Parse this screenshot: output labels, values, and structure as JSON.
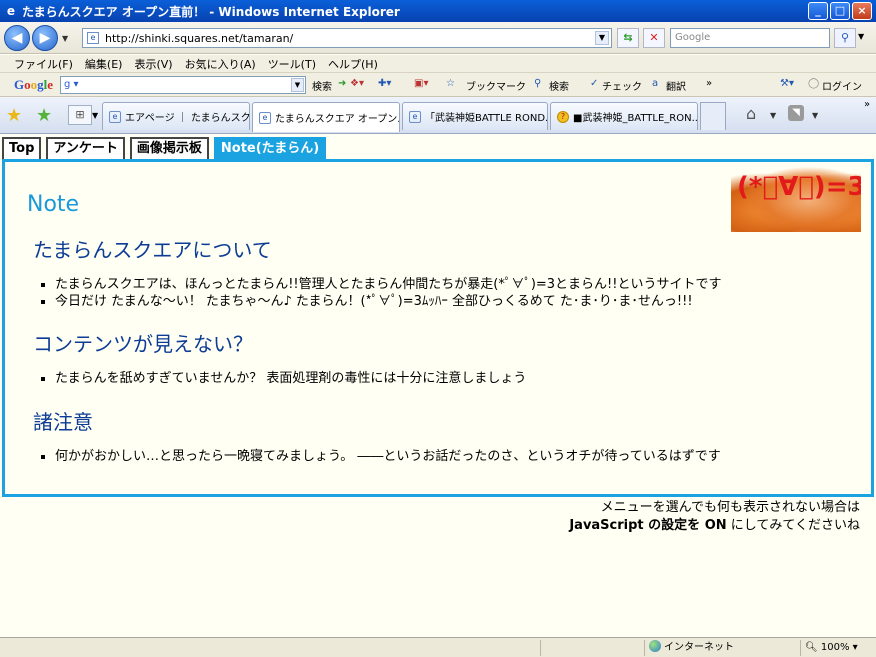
{
  "window": {
    "title": "たまらんスクエア オープン直前！ - Windows Internet Explorer",
    "buttons": {
      "minimize": "_",
      "maximize": "□",
      "close": "×"
    }
  },
  "address_bar": {
    "url": "http://shinki.squares.net/tamaran/",
    "search_placeholder": "Google"
  },
  "menu": [
    "ファイル(F)",
    "編集(E)",
    "表示(V)",
    "お気に入り(A)",
    "ツール(T)",
    "ヘルプ(H)"
  ],
  "google_toolbar": {
    "logo": [
      "G",
      "o",
      "o",
      "g",
      "l",
      "e"
    ],
    "search_value": "g ▾",
    "items": {
      "search": "検索",
      "bookmarks": "ブックマーク",
      "search2": "検索",
      "check": "チェック",
      "translate": "翻訳",
      "more": "»",
      "login": "ログイン"
    }
  },
  "browser_tabs": [
    {
      "label": "エアページ ｜ たまらんスクエア",
      "active": false
    },
    {
      "label": "たまらんスクエア オープン...",
      "active": true,
      "close": "×"
    },
    {
      "label": "「武装神姫BATTLE ROND...",
      "active": false
    },
    {
      "label": "■武装神姫_BATTLE_RON...",
      "active": false
    }
  ],
  "site_tabs": [
    {
      "label": "Top",
      "active": false
    },
    {
      "label": "アンケート",
      "active": false
    },
    {
      "label": "画像掲示板",
      "active": false
    },
    {
      "label": "Note(たまらん)",
      "active": true
    }
  ],
  "content": {
    "note_title": "Note",
    "mascot_text": "(*ﾟ∀ﾟ)=3",
    "sections": [
      {
        "heading": "たまらんスクエアについて",
        "items": [
          "たまらんスクエアは、ほんっとたまらん!!管理人とたまらん仲間たちが暴走(*ﾟ∀ﾟ)=3とまらん!!というサイトです",
          "今日だけ たまんな～い！ たまちゃ～ん♪ たまらん！(*ﾟ∀ﾟ)=3ﾑｯﾊｰ 全部ひっくるめて た･ま･り･ま･せんっ!!!"
        ]
      },
      {
        "heading": "コンテンツが見えない？",
        "items": [
          "たまらんを舐めすぎていませんか？ 表面処理剤の毒性には十分に注意しましょう"
        ]
      },
      {
        "heading": "諸注意",
        "items": [
          "何かがおかしい…と思ったら一晩寝てみましょう。 ――というお話だったのさ、というオチが待っているはずです"
        ]
      }
    ],
    "footnote_line1": "メニューを選んでも何も表示されない場合は",
    "footnote_js": "JavaScript の設定を ON",
    "footnote_tail": "にしてみてくださいね"
  },
  "status_bar": {
    "zone": "インターネット",
    "zoom": "100%"
  }
}
